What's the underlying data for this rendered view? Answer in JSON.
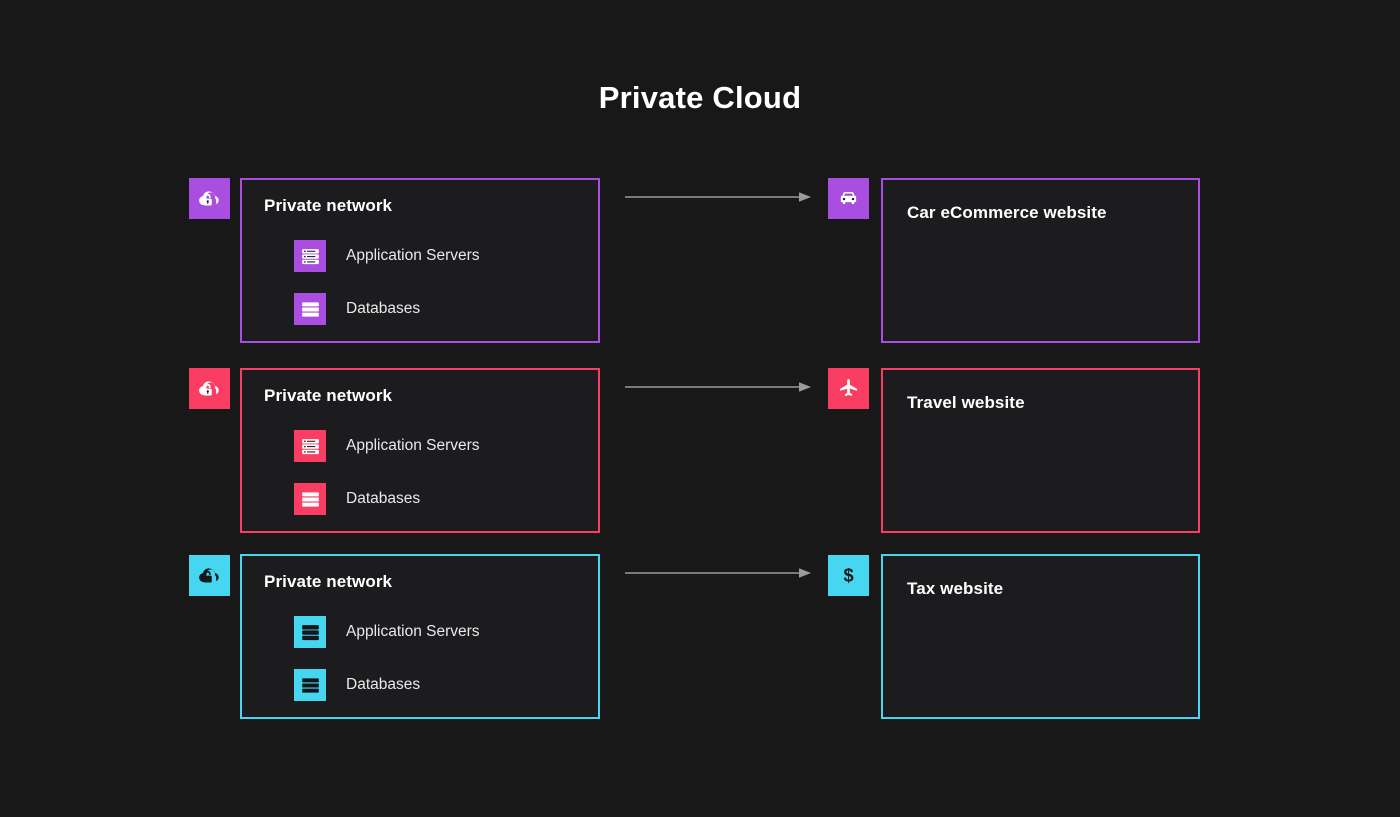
{
  "title": "Private Cloud",
  "theme": {
    "background": "#181818",
    "panel_fill": "#1c1c1e",
    "text": "#ffffff",
    "muted_text": "#e9e9ea",
    "arrow": "#9a9a9a"
  },
  "rows": [
    {
      "color": "#a94ee0",
      "glyph_color": "#ffffff",
      "cloud_icon": "private-cloud-lock-icon",
      "network": {
        "title": "Private network",
        "services": [
          {
            "label": "Application Servers",
            "icon": "server-rack-icon"
          },
          {
            "label": "Databases",
            "icon": "database-icon"
          }
        ]
      },
      "site": {
        "label": "Car eCommerce website",
        "icon": "car-icon"
      }
    },
    {
      "color": "#fa3e63",
      "glyph_color": "#ffffff",
      "cloud_icon": "private-cloud-lock-icon",
      "network": {
        "title": "Private network",
        "services": [
          {
            "label": "Application Servers",
            "icon": "server-rack-icon"
          },
          {
            "label": "Databases",
            "icon": "database-icon"
          }
        ]
      },
      "site": {
        "label": "Travel website",
        "icon": "airplane-icon"
      }
    },
    {
      "color": "#46d6f0",
      "glyph_color": "#15161a",
      "cloud_icon": "private-cloud-lock-icon",
      "network": {
        "title": "Private network",
        "services": [
          {
            "label": "Application Servers",
            "icon": "server-rack-icon"
          },
          {
            "label": "Databases",
            "icon": "database-icon"
          }
        ]
      },
      "site": {
        "label": "Tax website",
        "icon": "dollar-icon"
      }
    }
  ]
}
